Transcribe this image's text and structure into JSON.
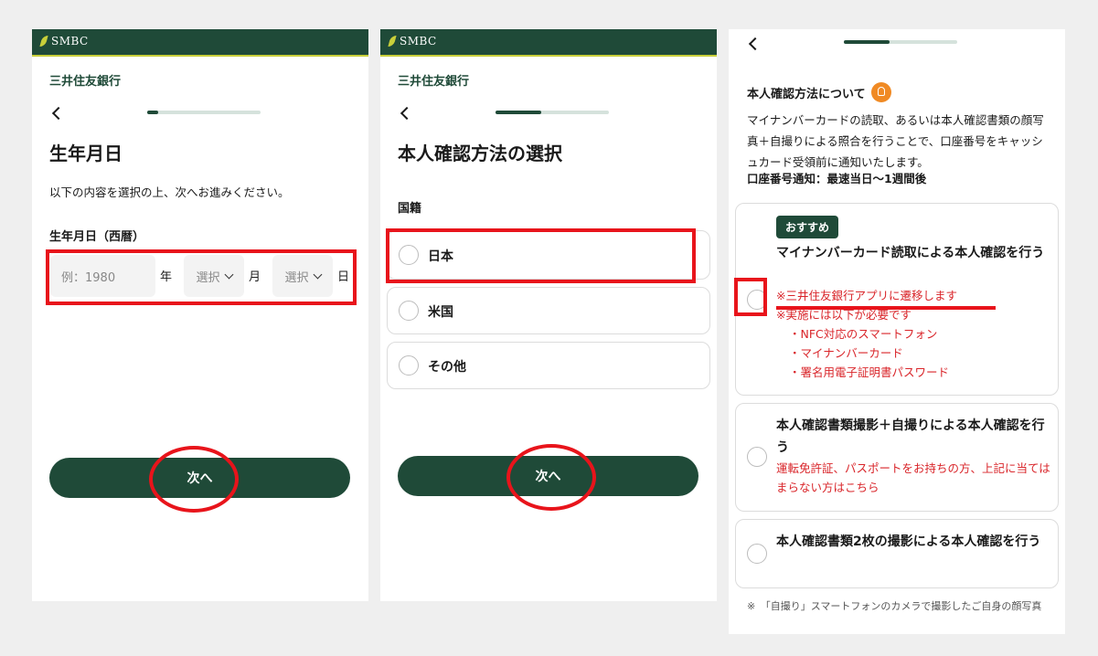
{
  "screens": [
    {
      "brand": "SMBC",
      "bank_name": "三井住友銀行",
      "progress_fraction": 0.1,
      "title": "生年月日",
      "instruction": "以下の内容を選択の上、次へお進みください。",
      "field_label": "生年月日（西暦）",
      "year_placeholder": "例：1980",
      "year_unit": "年",
      "month_select": "選択",
      "month_unit": "月",
      "day_select": "選択",
      "day_unit": "日",
      "next_label": "次へ"
    },
    {
      "brand": "SMBC",
      "bank_name": "三井住友銀行",
      "progress_fraction": 0.4,
      "title": "本人確認方法の選択",
      "field_label": "国籍",
      "options": [
        "日本",
        "米国",
        "その他"
      ],
      "next_label": "次へ"
    },
    {
      "progress_fraction": 0.4,
      "heading": "本人確認方法について",
      "description": "マイナンバーカードの読取、あるいは本人確認書類の顔写真＋自撮りによる照合を行うことで、口座番号をキャッシュカード受領前に通知いたします。",
      "notice": "口座番号通知：最速当日〜1週間後",
      "options": [
        {
          "badge": "おすすめ",
          "title": "マイナンバーカード読取による本人確認を行う",
          "notes": [
            "※三井住友銀行アプリに遷移します",
            "※実施には以下が必要です",
            "・NFC対応のスマートフォン",
            "・マイナンバーカード",
            "・署名用電子証明書パスワード"
          ]
        },
        {
          "title": "本人確認書類撮影＋自撮りによる本人確認を行う",
          "notes": [
            "運転免許証、パスポートをお持ちの方、上記に当てはまらない方はこちら"
          ]
        },
        {
          "title": "本人確認書類2枚の撮影による本人確認を行う"
        }
      ],
      "footnote": "※　「自撮り」スマートフォンのカメラで撮影したご自身の顔写真"
    }
  ],
  "colors": {
    "brand_green": "#1f4a38",
    "brand_accent": "#c8cf3a",
    "highlight_red": "#e8141b",
    "note_red": "#d9252a"
  }
}
